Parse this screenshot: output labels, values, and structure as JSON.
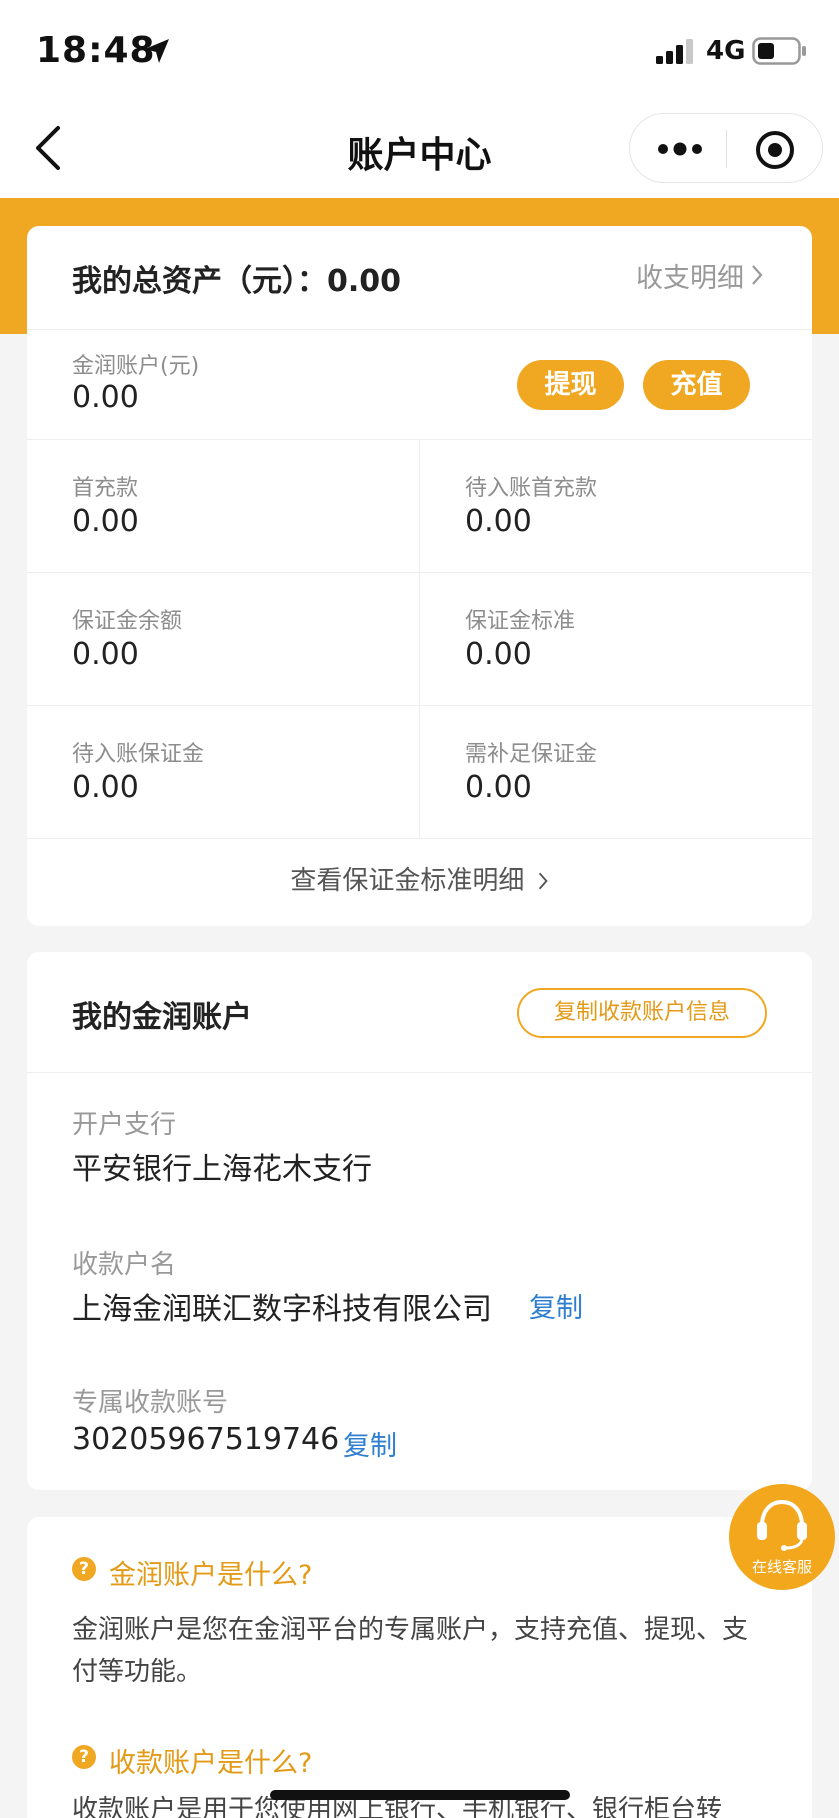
{
  "status": {
    "time": "18:48",
    "network": "4G"
  },
  "nav": {
    "title": "账户中心"
  },
  "summary": {
    "total_label": "我的总资产（元）：",
    "total_value": "0.00",
    "detail_link": "收支明细"
  },
  "jinrun": {
    "label": "金润账户(元)",
    "value": "0.00",
    "withdraw": "提现",
    "recharge": "充值"
  },
  "balances": [
    {
      "label": "首充款",
      "value": "0.00"
    },
    {
      "label": "待入账首充款",
      "value": "0.00"
    },
    {
      "label": "保证金余额",
      "value": "0.00"
    },
    {
      "label": "保证金标准",
      "value": "0.00"
    },
    {
      "label": "待入账保证金",
      "value": "0.00"
    },
    {
      "label": "需补足保证金",
      "value": "0.00"
    }
  ],
  "deposit_standard_link": "查看保证金标准明细",
  "account": {
    "title": "我的金润账户",
    "copy_info_button": "复制收款账户信息",
    "bank_label": "开户支行",
    "bank_value": "平安银行上海花木支行",
    "name_label": "收款户名",
    "name_value": "上海金润联汇数字科技有限公司",
    "number_label": "专属收款账号",
    "number_value": "30205967519746",
    "copy": "复制"
  },
  "faq": [
    {
      "question": "金润账户是什么?",
      "answer": "金润账户是您在金润平台的专属账户，支持充值、提现、支付等功能。"
    },
    {
      "question": "收款账户是什么?",
      "answer": "收款账户是用于您使用网上银行、手机银行、银行柜台转"
    }
  ],
  "faq_icon": "?",
  "service": {
    "label": "在线客服"
  },
  "colors": {
    "accent": "#f0a722",
    "link": "#2f7fd1"
  }
}
